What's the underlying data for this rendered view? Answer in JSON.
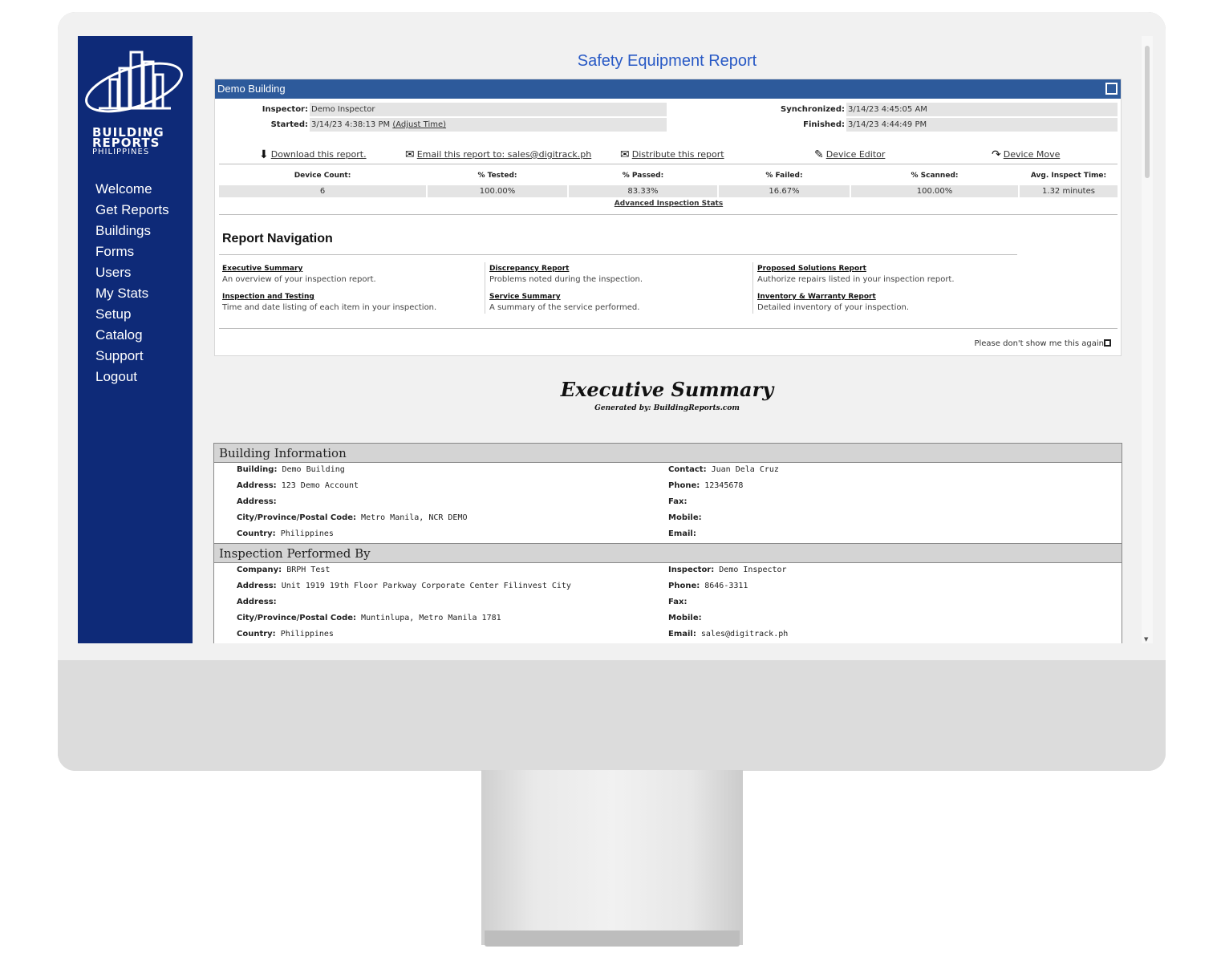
{
  "sidebar": {
    "logo": {
      "line1": "BUILDING",
      "line2": "REPORTS",
      "line3": "PHILIPPINES"
    },
    "items": [
      {
        "label": "Welcome"
      },
      {
        "label": "Get Reports"
      },
      {
        "label": "Buildings"
      },
      {
        "label": "Forms"
      },
      {
        "label": "Users"
      },
      {
        "label": "My Stats"
      },
      {
        "label": "Setup"
      },
      {
        "label": "Catalog"
      },
      {
        "label": "Support"
      },
      {
        "label": "Logout"
      }
    ]
  },
  "page_title": "Safety Equipment Report",
  "panel": {
    "title": "Demo Building",
    "inspector_label": "Inspector:",
    "inspector": "Demo Inspector",
    "started_label": "Started:",
    "started": "3/14/23 4:38:13 PM",
    "adjust_time": "(Adjust Time)",
    "synchronized_label": "Synchronized:",
    "synchronized": "3/14/23 4:45:05 AM",
    "finished_label": "Finished:",
    "finished": "3/14/23 4:44:49 PM",
    "actions": {
      "download": "Download this report.",
      "email": "Email this report to: sales@digitrack.ph",
      "distribute": "Distribute this report",
      "device_editor": "Device Editor",
      "device_move": "Device Move"
    },
    "stats": {
      "headers": [
        "Device Count:",
        "% Tested:",
        "% Passed:",
        "% Failed:",
        "% Scanned:",
        "Avg. Inspect Time:"
      ],
      "values": [
        "6",
        "100.00%",
        "83.33%",
        "16.67%",
        "100.00%",
        "1.32 minutes"
      ],
      "advanced": "Advanced Inspection Stats"
    },
    "nav_title": "Report Navigation",
    "nav": [
      {
        "title": "Executive Summary",
        "desc": "An overview of your inspection report."
      },
      {
        "title": "Inspection and Testing",
        "desc": "Time and date listing of each item in your inspection."
      },
      {
        "title": "Discrepancy Report",
        "desc": "Problems noted during the inspection."
      },
      {
        "title": "Service Summary",
        "desc": "A summary of the service performed."
      },
      {
        "title": "Proposed Solutions Report",
        "desc": "Authorize repairs listed in your inspection report."
      },
      {
        "title": "Inventory & Warranty Report",
        "desc": "Detailed inventory of your inspection."
      }
    ],
    "dont_show": "Please don't show me this again"
  },
  "summary": {
    "title": "Executive Summary",
    "generated": "Generated by: BuildingReports.com"
  },
  "building_info": {
    "header": "Building Information",
    "left": [
      {
        "label": "Building:",
        "value": "Demo Building"
      },
      {
        "label": "Address:",
        "value": "123 Demo Account"
      },
      {
        "label": "Address:",
        "value": ""
      },
      {
        "label": "City/Province/Postal Code:",
        "value": "Metro Manila, NCR DEMO"
      },
      {
        "label": "Country:",
        "value": "Philippines"
      }
    ],
    "right": [
      {
        "label": "Contact:",
        "value": "Juan Dela Cruz"
      },
      {
        "label": "Phone:",
        "value": "12345678"
      },
      {
        "label": "Fax:",
        "value": ""
      },
      {
        "label": "Mobile:",
        "value": ""
      },
      {
        "label": "Email:",
        "value": ""
      }
    ]
  },
  "inspection_by": {
    "header": "Inspection Performed By",
    "left": [
      {
        "label": "Company:",
        "value": "BRPH Test"
      },
      {
        "label": "Address:",
        "value": "Unit 1919 19th Floor Parkway Corporate Center Filinvest City"
      },
      {
        "label": "Address:",
        "value": ""
      },
      {
        "label": "City/Province/Postal Code:",
        "value": "Muntinlupa, Metro Manila 1781"
      },
      {
        "label": "Country:",
        "value": "Philippines"
      }
    ],
    "right": [
      {
        "label": "Inspector:",
        "value": "Demo Inspector"
      },
      {
        "label": "Phone:",
        "value": "8646-3311"
      },
      {
        "label": "Fax:",
        "value": ""
      },
      {
        "label": "Mobile:",
        "value": ""
      },
      {
        "label": "Email:",
        "value": "sales@digitrack.ph"
      }
    ]
  }
}
